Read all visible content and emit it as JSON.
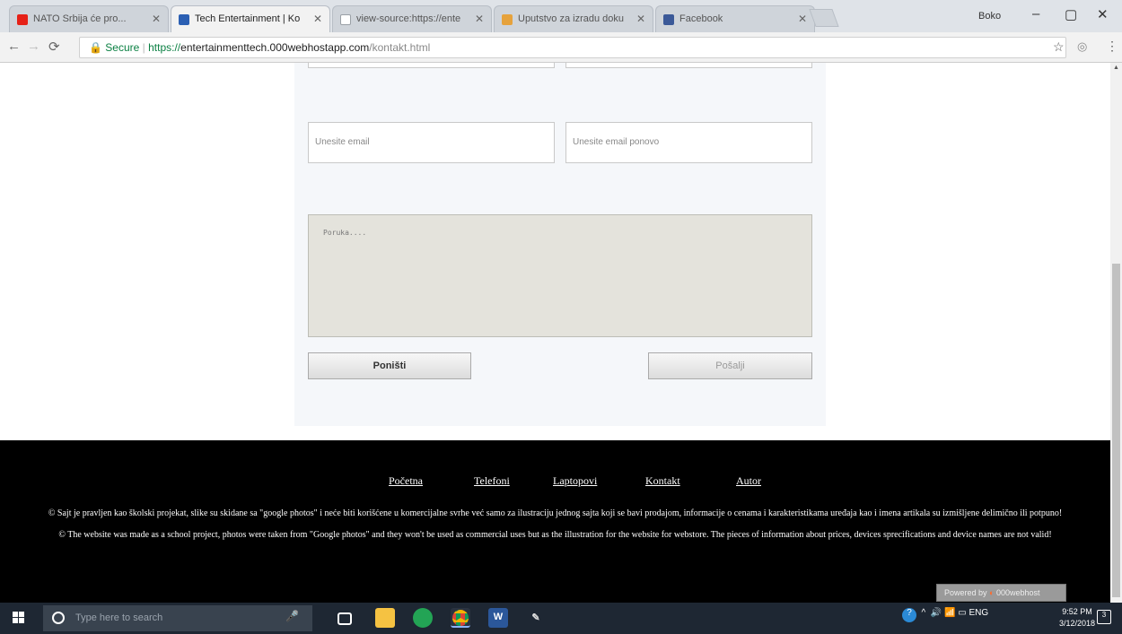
{
  "browser": {
    "tabs": [
      {
        "label": "NATO Srbija će pro...",
        "favicon": "youtube-icon",
        "color": "#e62117"
      },
      {
        "label": "Tech Entertainment | Ko",
        "favicon": "site-icon",
        "color": "#2b5fb3"
      },
      {
        "label": "view-source:https://ente",
        "favicon": "page-icon",
        "color": "#9aa0a6"
      },
      {
        "label": "Uputstvo za izradu doku",
        "favicon": "doc-icon",
        "color": "#e6a23c"
      },
      {
        "label": "Facebook",
        "favicon": "facebook-icon",
        "color": "#3b5998"
      }
    ],
    "profile": "Boko",
    "window_controls": {
      "minimize": "–",
      "maximize": "▢",
      "close": "✕"
    },
    "address": {
      "security": "Secure",
      "protocol": "https://",
      "host": "entertainmenttech.000webhostapp.com",
      "path": "/kontakt.html"
    }
  },
  "form": {
    "email_placeholder": "Unesite email",
    "email_repeat_placeholder": "Unesite email ponovo",
    "message_placeholder": "Poruka....",
    "reset_label": "Poništi",
    "send_label": "Pošalji"
  },
  "footer": {
    "nav": [
      "Početna",
      "Telefoni",
      "Laptopovi",
      "Kontakt",
      "Autor"
    ],
    "notice_sr": "© Sajt je pravljen kao školski projekat, slike su skidane sa \"google photos\" i neće biti korišćene u komercijalne svrhe već samo za ilustraciju jednog sajta koji se bavi prodajom, informacije o cenama i karakteristikama uređaja kao i imena artikala su izmišljene delimično ili potpuno!",
    "notice_en": "© The website was made as a school project, photos were taken from \"Google photos\" and they won't be used as commercial uses but as the illustration for the website for webstore. The pieces of information about prices, devices sprecifications and device names are not valid!",
    "powered_prefix": "Powered by",
    "powered_brand": "000webhost"
  },
  "taskbar": {
    "search_placeholder": "Type here to search",
    "language": "ENG",
    "time": "9:52 PM",
    "date": "3/12/2018"
  }
}
